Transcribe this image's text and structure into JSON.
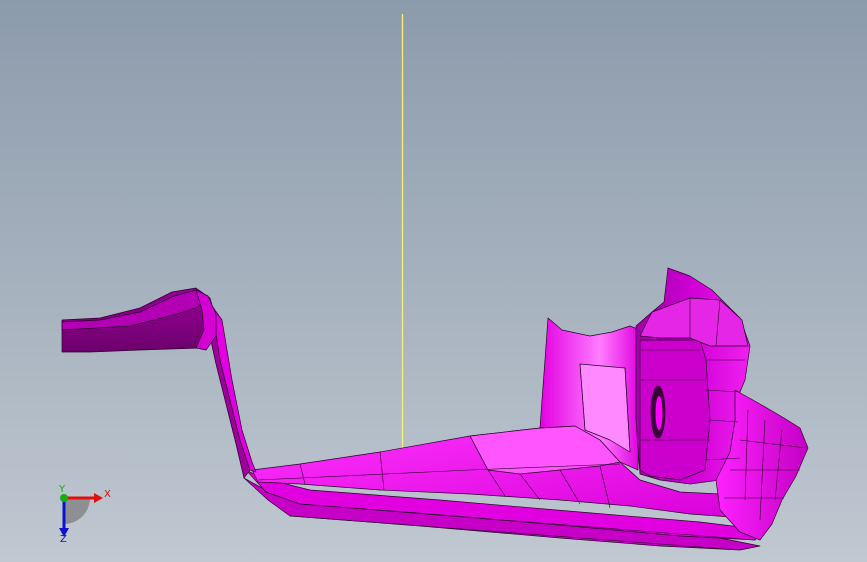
{
  "viewport": {
    "background_top": "#8c9bac",
    "background_bottom": "#c0c8d1"
  },
  "model": {
    "color": "#ff00ff",
    "shade_dark": "#b000b0",
    "shade_light": "#ff66ff",
    "edge_color": "#2a002a"
  },
  "guide_line": {
    "color": "#f2f27a"
  },
  "triad": {
    "x_label": "X",
    "y_label": "Y",
    "z_label": "Z",
    "x_color": "#e01010",
    "y_color": "#10b010",
    "z_color": "#1010d0"
  }
}
